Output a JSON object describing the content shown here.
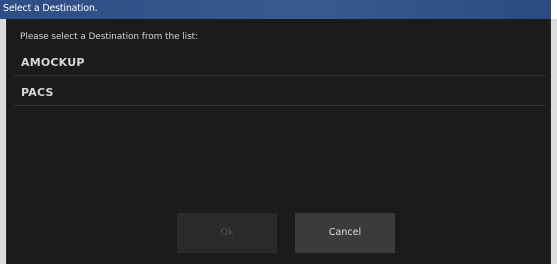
{
  "dialog": {
    "title": "Select a Destination.",
    "prompt": "Please select a Destination from the list:",
    "destinations": [
      {
        "label": "AMOCKUP"
      },
      {
        "label": "PACS"
      }
    ],
    "buttons": {
      "ok_label": "Ok",
      "ok_enabled": false,
      "cancel_label": "Cancel"
    },
    "colors": {
      "titlebar": "#2e4d84",
      "background": "#191919",
      "button": "#3b3b3b",
      "text": "#d8d8d8"
    }
  }
}
